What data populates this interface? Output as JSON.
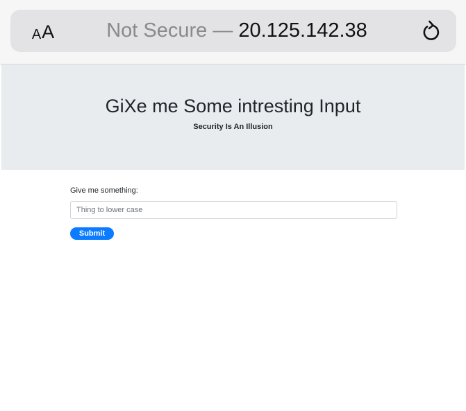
{
  "browser": {
    "text_size_small": "A",
    "text_size_large": "A",
    "url_security_label": "Not Secure —",
    "url_host": "20.125.142.38",
    "reload_icon": "reload-icon"
  },
  "header": {
    "title": "GiXe me Some intresting Input",
    "subtitle": "Security Is An Illusion",
    "background_color": "#e9ecef"
  },
  "form": {
    "label": "Give me something:",
    "input_placeholder": "Thing to lower case",
    "input_value": "",
    "submit_label": "Submit",
    "submit_color": "#0b7bff"
  }
}
